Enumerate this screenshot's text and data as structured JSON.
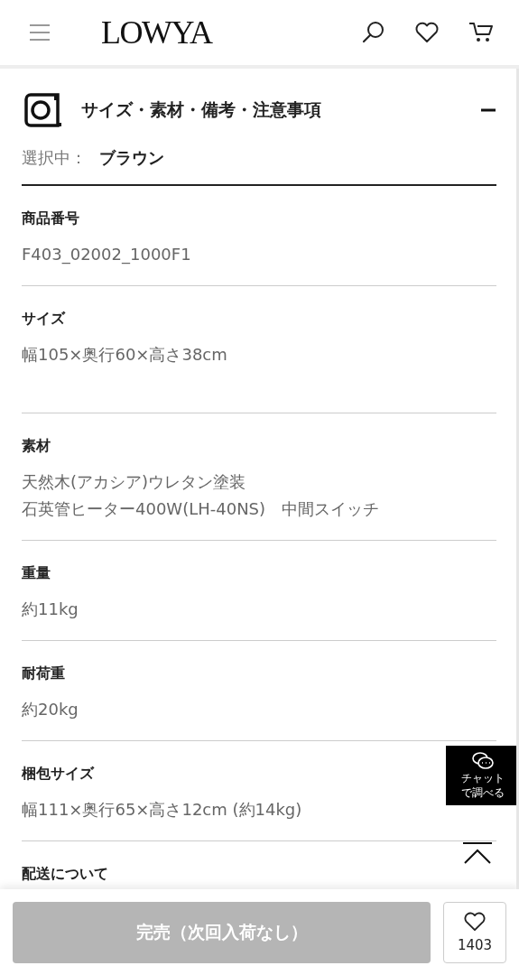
{
  "header": {
    "logo": "LOWYA"
  },
  "section": {
    "title": "サイズ・素材・備考・注意事項",
    "expanded": true
  },
  "selection": {
    "label": "選択中：",
    "value": "ブラウン"
  },
  "specs": [
    {
      "label": "商品番号",
      "lines": [
        "F403_02002_1000F1"
      ]
    },
    {
      "label": "サイズ",
      "lines": [
        "幅105×奥行60×高さ38cm"
      ]
    },
    {
      "label": "素材",
      "lines": [
        "天然木(アカシア)ウレタン塗装",
        "石英管ヒーター400W(LH-40NS)　中間スイッチ"
      ]
    },
    {
      "label": "重量",
      "lines": [
        "約11kg"
      ]
    },
    {
      "label": "耐荷重",
      "lines": [
        "約20kg"
      ]
    },
    {
      "label": "梱包サイズ",
      "lines": [
        "幅111×奥行65×高さ12cm (約14kg)"
      ]
    },
    {
      "label": "配送について"
    }
  ],
  "chat_button": {
    "label": "チャットで調べる"
  },
  "buy_button": {
    "label": "完売（次回入荷なし）",
    "disabled": true
  },
  "favorite": {
    "count": "1403"
  }
}
